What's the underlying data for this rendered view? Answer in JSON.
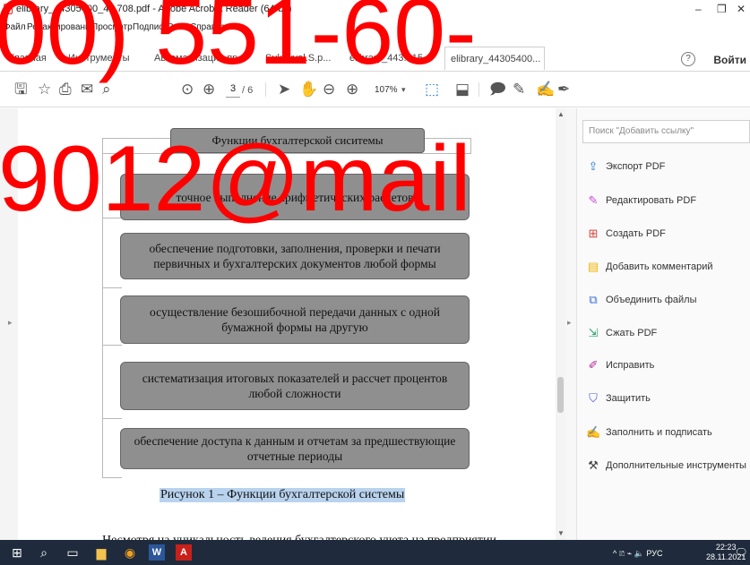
{
  "window": {
    "title": "elibrary_44305400_4...708.pdf - Adobe Acrobat Reader (64-bit)",
    "minimize": "–",
    "restore": "❐",
    "close": "✕"
  },
  "menu": [
    "Файл",
    "Редактирование",
    "Просмотр",
    "Подпись",
    "Окно",
    "Справка"
  ],
  "tabs": {
    "home": "Главная",
    "tools": "Инструменты",
    "items": [
      {
        "label": "Автоматизация пр..."
      },
      {
        "label": "Sukovval.S.p..."
      },
      {
        "label": "elibrary_443...15..."
      },
      {
        "label": "elibrary_44305400..."
      }
    ],
    "close": "×",
    "help": "?",
    "signin": "Войти"
  },
  "toolbar": {
    "page_current": "3",
    "page_total": "/ 6",
    "zoom": "107%",
    "zoom_arrow": "▾"
  },
  "document": {
    "diagram_title": "Функции бухгалтерской сиситемы",
    "boxes": [
      "точное выполнение арифметических расчетов",
      "обеспечение подготовки, заполнения, проверки и печати первичных и бухгалтерских документов любой формы",
      "осуществление безошибочной передачи данных с одной бумажной формы на другую",
      "систематизация итоговых показателей и рассчет процентов любой сложности",
      "обеспечение доступа к данным и отчетам за предшествующие отчетные периоды"
    ],
    "caption": "Рисунок 1 – Функции бухгалтерской системы",
    "body": "Несмотря на уникальность ведения бухгалтерского учета на предприятии"
  },
  "right_panel": {
    "search_placeholder": "Поиск \"Добавить ссылку\"",
    "tools": [
      {
        "label": "Экспорт PDF",
        "icon": "export-pdf-icon",
        "color": "#2a7fd4"
      },
      {
        "label": "Редактировать PDF",
        "icon": "edit-pdf-icon",
        "color": "#c84fd0"
      },
      {
        "label": "Создать PDF",
        "icon": "create-pdf-icon",
        "color": "#d9433f"
      },
      {
        "label": "Добавить комментарий",
        "icon": "comment-icon",
        "color": "#f0b400"
      },
      {
        "label": "Объединить файлы",
        "icon": "combine-files-icon",
        "color": "#3b6fd8"
      },
      {
        "label": "Сжать PDF",
        "icon": "compress-pdf-icon",
        "color": "#2aa16a"
      },
      {
        "label": "Исправить",
        "icon": "fill-sign-pen-icon",
        "color": "#b1269a"
      },
      {
        "label": "Защитить",
        "icon": "shield-icon",
        "color": "#4a5ccf"
      },
      {
        "label": "Заполнить и подписать",
        "icon": "sign-pen-icon",
        "color": "#8e3ad0"
      },
      {
        "label": "Дополнительные инструменты",
        "icon": "more-tools-icon",
        "color": "#444444"
      }
    ]
  },
  "taskbar": {
    "tray": "^ 🗈 ⌁ 🔈 РУС",
    "time": "22:23",
    "date": "28.11.2021"
  },
  "watermark": {
    "line1": "00) 551-60-",
    "line2": "9012@mail",
    "color": "#ff0000"
  }
}
